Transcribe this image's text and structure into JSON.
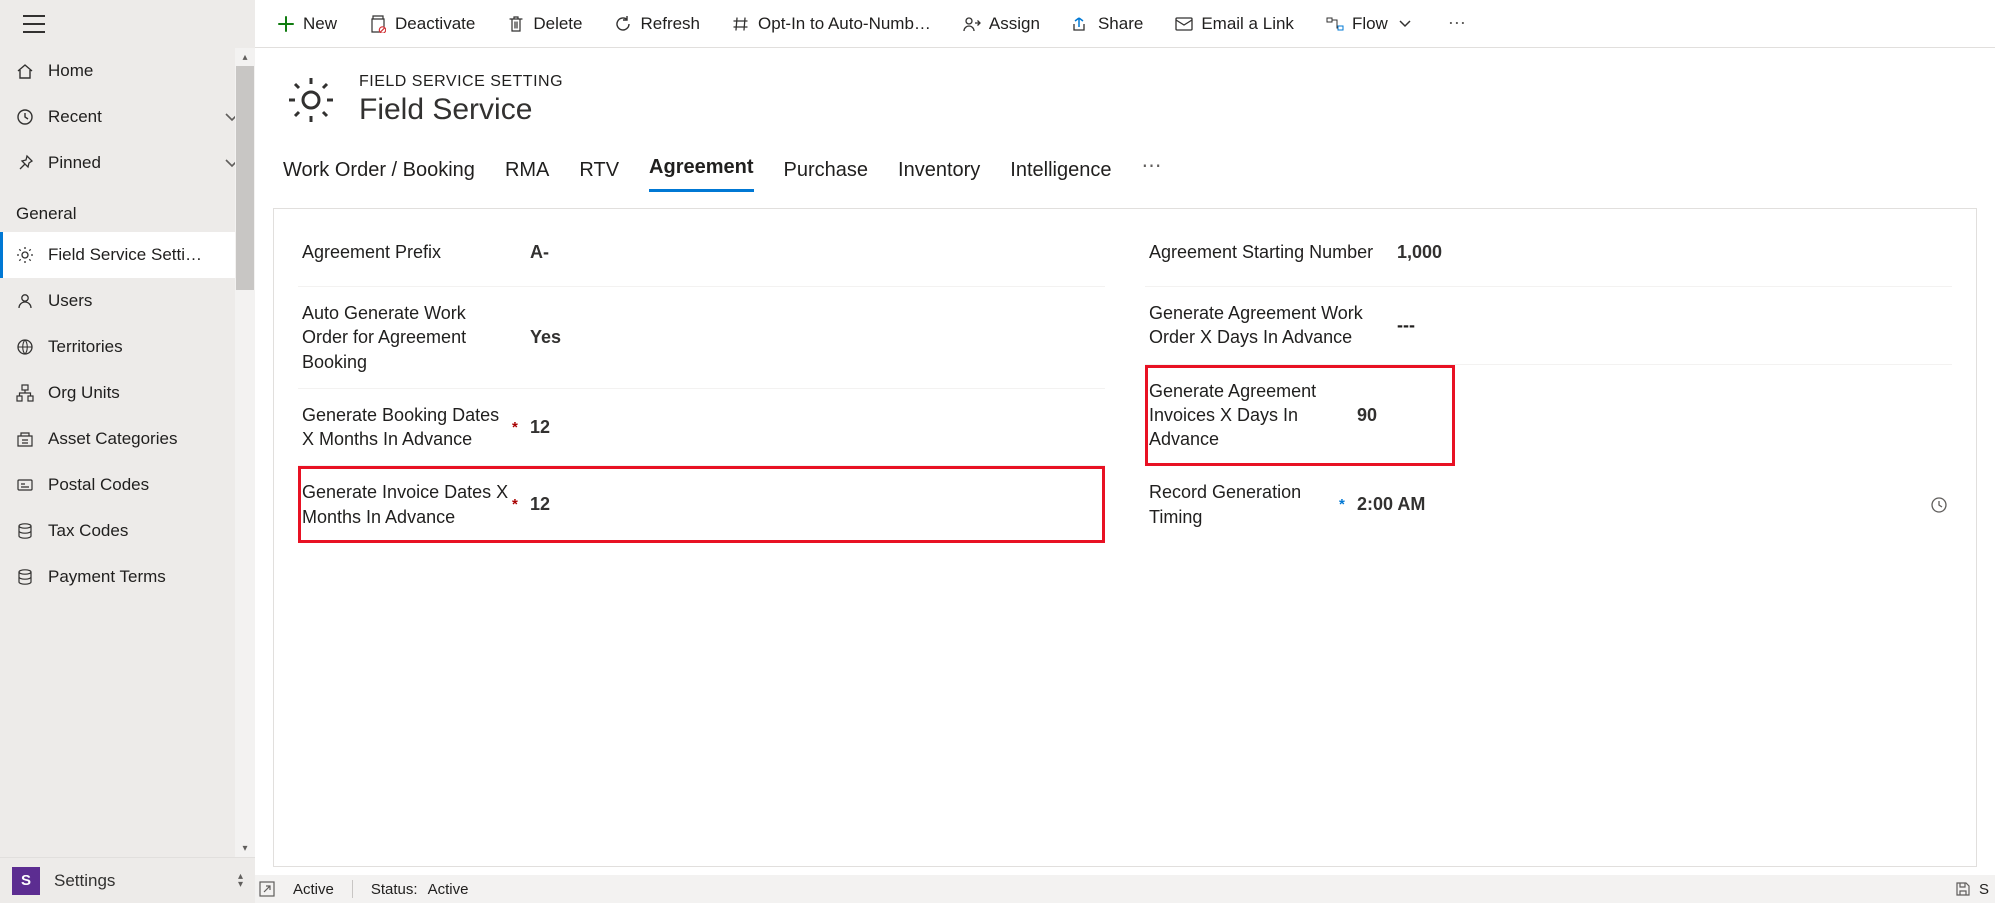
{
  "commandBar": {
    "new": "New",
    "deactivate": "Deactivate",
    "delete": "Delete",
    "refresh": "Refresh",
    "optIn": "Opt-In to Auto-Numb…",
    "assign": "Assign",
    "share": "Share",
    "emailLink": "Email a Link",
    "flow": "Flow"
  },
  "sidebar": {
    "home": "Home",
    "recent": "Recent",
    "pinned": "Pinned",
    "sectionHeader": "General",
    "items": {
      "fieldServiceSettings": "Field Service Setti…",
      "users": "Users",
      "territories": "Territories",
      "orgUnits": "Org Units",
      "assetCategories": "Asset Categories",
      "postalCodes": "Postal Codes",
      "taxCodes": "Tax Codes",
      "paymentTerms": "Payment Terms"
    },
    "footerBadge": "S",
    "footerLabel": "Settings"
  },
  "header": {
    "eyebrow": "FIELD SERVICE SETTING",
    "title": "Field Service"
  },
  "tabs": {
    "workOrderBooking": "Work Order / Booking",
    "rma": "RMA",
    "rtv": "RTV",
    "agreement": "Agreement",
    "purchase": "Purchase",
    "inventory": "Inventory",
    "intelligence": "Intelligence"
  },
  "form": {
    "left": {
      "agreementPrefix": {
        "label": "Agreement Prefix",
        "value": "A-"
      },
      "autoGenerateWorkOrder": {
        "label": "Auto Generate Work Order for Agreement Booking",
        "value": "Yes"
      },
      "generateBookingDates": {
        "label": "Generate Booking Dates X Months In Advance",
        "value": "12",
        "required": true
      },
      "generateInvoiceDates": {
        "label": "Generate Invoice Dates X Months In Advance",
        "value": "12",
        "required": true
      }
    },
    "right": {
      "agreementStartingNumber": {
        "label": "Agreement Starting Number",
        "value": "1,000"
      },
      "generateAgreementWorkOrderDays": {
        "label": "Generate Agreement Work Order X Days In Advance",
        "value": "---"
      },
      "generateAgreementInvoicesDays": {
        "label": "Generate Agreement Invoices X Days In Advance",
        "value": "90"
      },
      "recordGenerationTiming": {
        "label": "Record Generation Timing",
        "value": "2:00 AM",
        "recommended": true
      }
    }
  },
  "statusBar": {
    "state": "Active",
    "statusLabel": "Status:",
    "statusValue": "Active",
    "saveHint": "S"
  }
}
